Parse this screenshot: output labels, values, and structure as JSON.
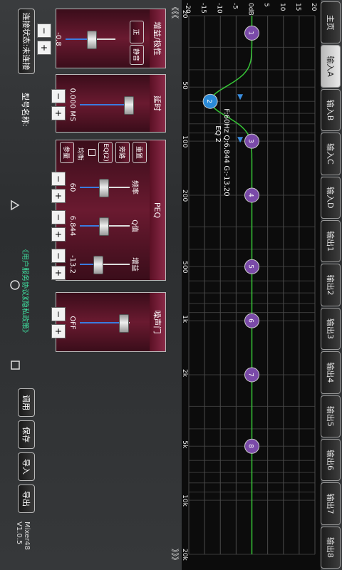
{
  "tabs": [
    "主页",
    "输入A",
    "输入B",
    "输入C",
    "输入D",
    "输出1",
    "输出2",
    "输出3",
    "输出4",
    "输出5",
    "输出6",
    "输出7",
    "输出8"
  ],
  "active_tab": 1,
  "graph": {
    "y_ticks": [
      "20",
      "15",
      "10",
      "5",
      "0dB",
      "-5",
      "-10",
      "-15",
      "-20"
    ],
    "x_ticks": [
      "20",
      "50",
      "100",
      "200",
      "500",
      "1k",
      "2k",
      "5k",
      "10k",
      "20k"
    ],
    "nodes": [
      {
        "label": "1",
        "freq": 25,
        "gain": 0
      },
      {
        "label": "2",
        "freq": 60,
        "gain": -13.2
      },
      {
        "label": "3",
        "freq": 100,
        "gain": 0
      },
      {
        "label": "4",
        "freq": 200,
        "gain": 0
      },
      {
        "label": "5",
        "freq": 500,
        "gain": 0
      },
      {
        "label": "6",
        "freq": 1000,
        "gain": 0
      },
      {
        "label": "7",
        "freq": 2000,
        "gain": 0
      },
      {
        "label": "8",
        "freq": 5000,
        "gain": 0
      }
    ],
    "info_line1": "F:60Hz Q:6.844 G:-13.20",
    "info_line2": "EQ 2",
    "curve_color": "#37c637",
    "node_color": "#7a4aa8",
    "selected_color": "#2a8ad8"
  },
  "panel_gain": {
    "title": "增益/极性",
    "value": "-0.8",
    "invert_label": "正",
    "mute_label": "静音"
  },
  "panel_delay": {
    "title": "延时",
    "value": "0.000 MS"
  },
  "panel_peq": {
    "title": "PEQ",
    "reset_label": "重置",
    "bypass_label": "旁路",
    "eq_label": "EQ(2)",
    "tuning_label": "均衡",
    "extra_label": "参量",
    "sliders": [
      {
        "label": "频率",
        "value": "60"
      },
      {
        "label": "Q值",
        "value": "6.844"
      },
      {
        "label": "增益",
        "value": "-13.2"
      }
    ]
  },
  "panel_noise": {
    "title": "噪声门",
    "value": "OFF"
  },
  "bottom": {
    "connect_label": "连接状态:未连接",
    "model_label": "型号名称:",
    "user_agreement": "《用户服务协议》",
    "privacy": "《隐私政策》",
    "buttons": [
      "调用",
      "保存",
      "导入",
      "导出"
    ],
    "version": "Mixer48 V1.0.5"
  },
  "nav": {
    "left": "《《《",
    "right": "》》》"
  }
}
